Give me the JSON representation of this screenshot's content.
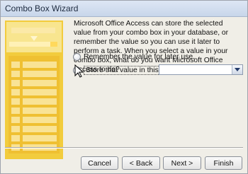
{
  "window": {
    "title": "Combo Box Wizard"
  },
  "wizard": {
    "prompt": "Microsoft Office Access can store the selected value from your combo box in your database, or remember the value so you can use it later to perform a task.  When you select a value in your combo box, what do you want Microsoft Office Access to do?",
    "options": {
      "remember": "Remember the value for later use.",
      "store": "Store that value in this field:"
    },
    "selected_option": "store",
    "field_value": ""
  },
  "buttons": {
    "cancel": "Cancel",
    "back": "< Back",
    "next": "Next >",
    "finish": "Finish"
  },
  "colors": {
    "illustration_yellow": "#f4d34a",
    "illustration_dark": "#e6b620",
    "title_bar": "#c8d6ea"
  }
}
